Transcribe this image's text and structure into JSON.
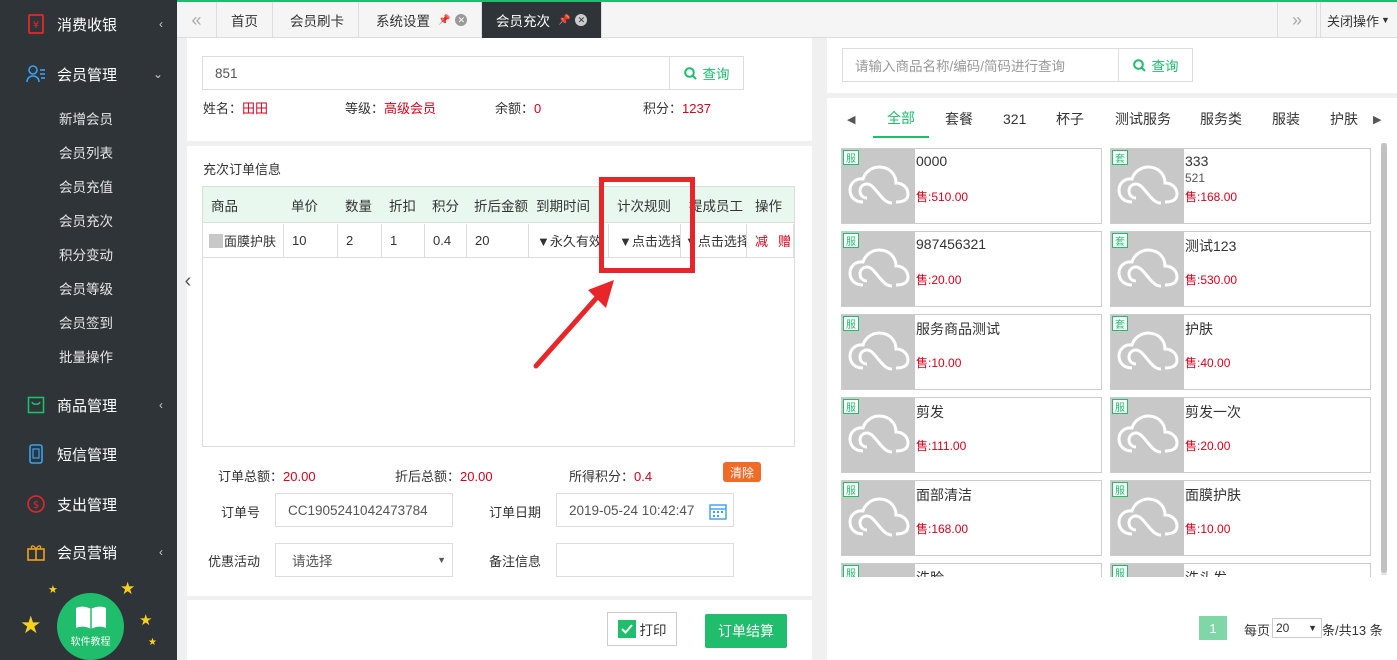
{
  "sidebar": {
    "menus": [
      {
        "label": "消费收银",
        "icon": "receipt-icon"
      },
      {
        "label": "会员管理",
        "icon": "members-icon"
      },
      {
        "label": "商品管理",
        "icon": "goods-icon"
      },
      {
        "label": "短信管理",
        "icon": "sms-icon"
      },
      {
        "label": "支出管理",
        "icon": "expense-icon"
      },
      {
        "label": "会员营销",
        "icon": "gift-icon"
      }
    ],
    "member_submenu": [
      "新增会员",
      "会员列表",
      "会员充值",
      "会员充次",
      "积分变动",
      "会员等级",
      "会员签到",
      "批量操作"
    ],
    "tutorial_label": "软件教程"
  },
  "tabs": {
    "items": [
      "首页",
      "会员刷卡",
      "系统设置",
      "会员充次"
    ],
    "close_ops": "关闭操作"
  },
  "member": {
    "search_value": "851",
    "query_label": "查询",
    "name_label": "姓名：",
    "name": "田田",
    "level_label": "等级：",
    "level": "高级会员",
    "balance_label": "余额：",
    "balance": "0",
    "points_label": "积分：",
    "points": "1237"
  },
  "order": {
    "title": "充次订单信息",
    "columns": [
      "商品",
      "单价",
      "数量",
      "折扣",
      "积分",
      "折后金额",
      "到期时间",
      "计次规则",
      "提成员工",
      "操作"
    ],
    "row": {
      "product": "面膜护肤",
      "price": "10",
      "qty": "2",
      "discount": "1",
      "points": "0.4",
      "after_amount": "20",
      "expiry": "▼永久有效",
      "rule": "▼点击选择",
      "staff": "▼点击选择",
      "op_minus": "减",
      "op_gift": "赠"
    },
    "total_label": "订单总额：",
    "total": "20.00",
    "after_total_label": "折后总额：",
    "after_total": "20.00",
    "earned_points_label": "所得积分：",
    "earned_points": "0.4",
    "clear_label": "清除",
    "order_no_label": "订单号",
    "order_no": "CC1905241042473784",
    "order_date_label": "订单日期",
    "order_date": "2019-05-24 10:42:47",
    "promo_label": "优惠活动",
    "promo_value": "请选择",
    "note_label": "备注信息",
    "note_value": "",
    "print_label": "打印",
    "settle_label": "订单结算"
  },
  "products": {
    "search_placeholder": "请输入商品名称/编码/简码进行查询",
    "query_label": "查询",
    "categories": [
      "全部",
      "套餐",
      "321",
      "杯子",
      "测试服务",
      "服务类",
      "服装",
      "护肤"
    ],
    "items": [
      {
        "badge": "服",
        "name": "0000",
        "code": "",
        "price": "售:510.00"
      },
      {
        "badge": "套",
        "name": "333",
        "code": "521",
        "price": "售:168.00"
      },
      {
        "badge": "服",
        "name": "987456321",
        "code": "",
        "price": "售:20.00"
      },
      {
        "badge": "套",
        "name": "测试123",
        "code": "",
        "price": "售:530.00"
      },
      {
        "badge": "服",
        "name": "服务商品测试",
        "code": "",
        "price": "售:10.00"
      },
      {
        "badge": "套",
        "name": "护肤",
        "code": "",
        "price": "售:40.00"
      },
      {
        "badge": "服",
        "name": "剪发",
        "code": "",
        "price": "售:111.00"
      },
      {
        "badge": "服",
        "name": "剪发一次",
        "code": "",
        "price": "售:20.00"
      },
      {
        "badge": "服",
        "name": "面部清洁",
        "code": "",
        "price": "售:168.00"
      },
      {
        "badge": "服",
        "name": "面膜护肤",
        "code": "",
        "price": "售:10.00"
      },
      {
        "badge": "服",
        "name": "洗脸",
        "code": "",
        "price": ""
      },
      {
        "badge": "服",
        "name": "洗头发",
        "code": "",
        "price": ""
      }
    ],
    "pagination": {
      "page": "1",
      "per_page_label": "每页",
      "per_page": "20",
      "total_label": "条/共13 条"
    }
  },
  "colors": {
    "accent": "#1fbd6c",
    "sidebar": "#2f3438",
    "price": "#d9001b",
    "link": "#3aa0f0",
    "highlight": "#e8262a"
  }
}
